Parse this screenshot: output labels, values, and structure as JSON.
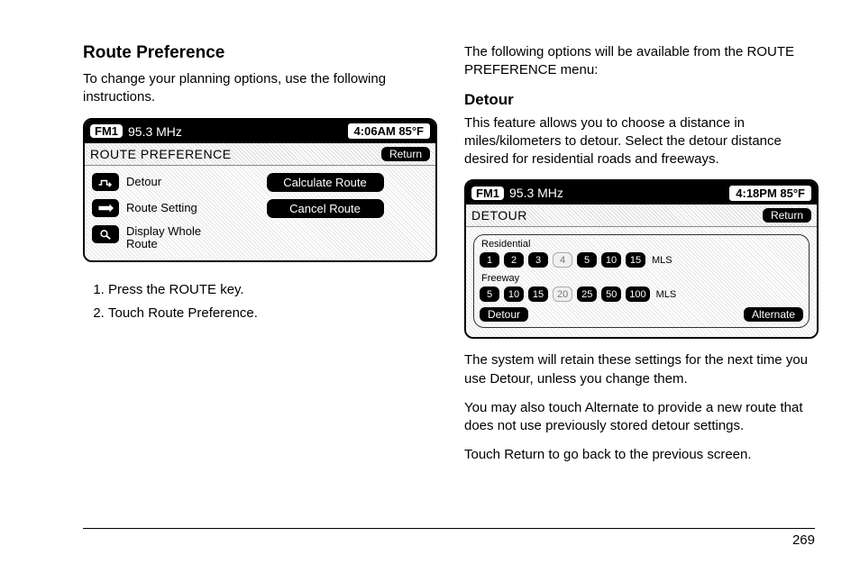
{
  "page_number": "269",
  "left": {
    "heading": "Route Preference",
    "intro": "To change your planning options, use the following instructions.",
    "steps": [
      "Press the ROUTE key.",
      "Touch Route Preference."
    ],
    "device": {
      "band": "FM1",
      "freq": "95.3 MHz",
      "clock": "4:06AM 85°F",
      "screen_title": "ROUTE PREFERENCE",
      "return_label": "Return",
      "items": [
        "Detour",
        "Route Setting",
        "Display Whole Route"
      ],
      "buttons": [
        "Calculate Route",
        "Cancel Route"
      ]
    }
  },
  "right": {
    "intro": "The following options will be available from the ROUTE PREFERENCE menu:",
    "heading": "Detour",
    "desc": "This feature allows you to choose a distance in miles/kilometers to detour. Select the detour distance desired for residential roads and freeways.",
    "device": {
      "band": "FM1",
      "freq": "95.3 MHz",
      "clock": "4:18PM 85°F",
      "screen_title": "DETOUR",
      "return_label": "Return",
      "group1_label": "Residential",
      "group1": [
        "1",
        "2",
        "3",
        "4",
        "5",
        "10",
        "15"
      ],
      "group1_sel_index": 3,
      "group2_label": "Freeway",
      "group2": [
        "5",
        "10",
        "15",
        "20",
        "25",
        "50",
        "100"
      ],
      "group2_sel_index": 3,
      "unit": "MLS",
      "bottom_left": "Detour",
      "bottom_right": "Alternate"
    },
    "para1": "The system will retain these settings for the next time you use Detour, unless you change them.",
    "para2": "You may also touch Alternate to provide a new route that does not use previously stored detour settings.",
    "para3": "Touch Return to go back to the previous screen."
  }
}
